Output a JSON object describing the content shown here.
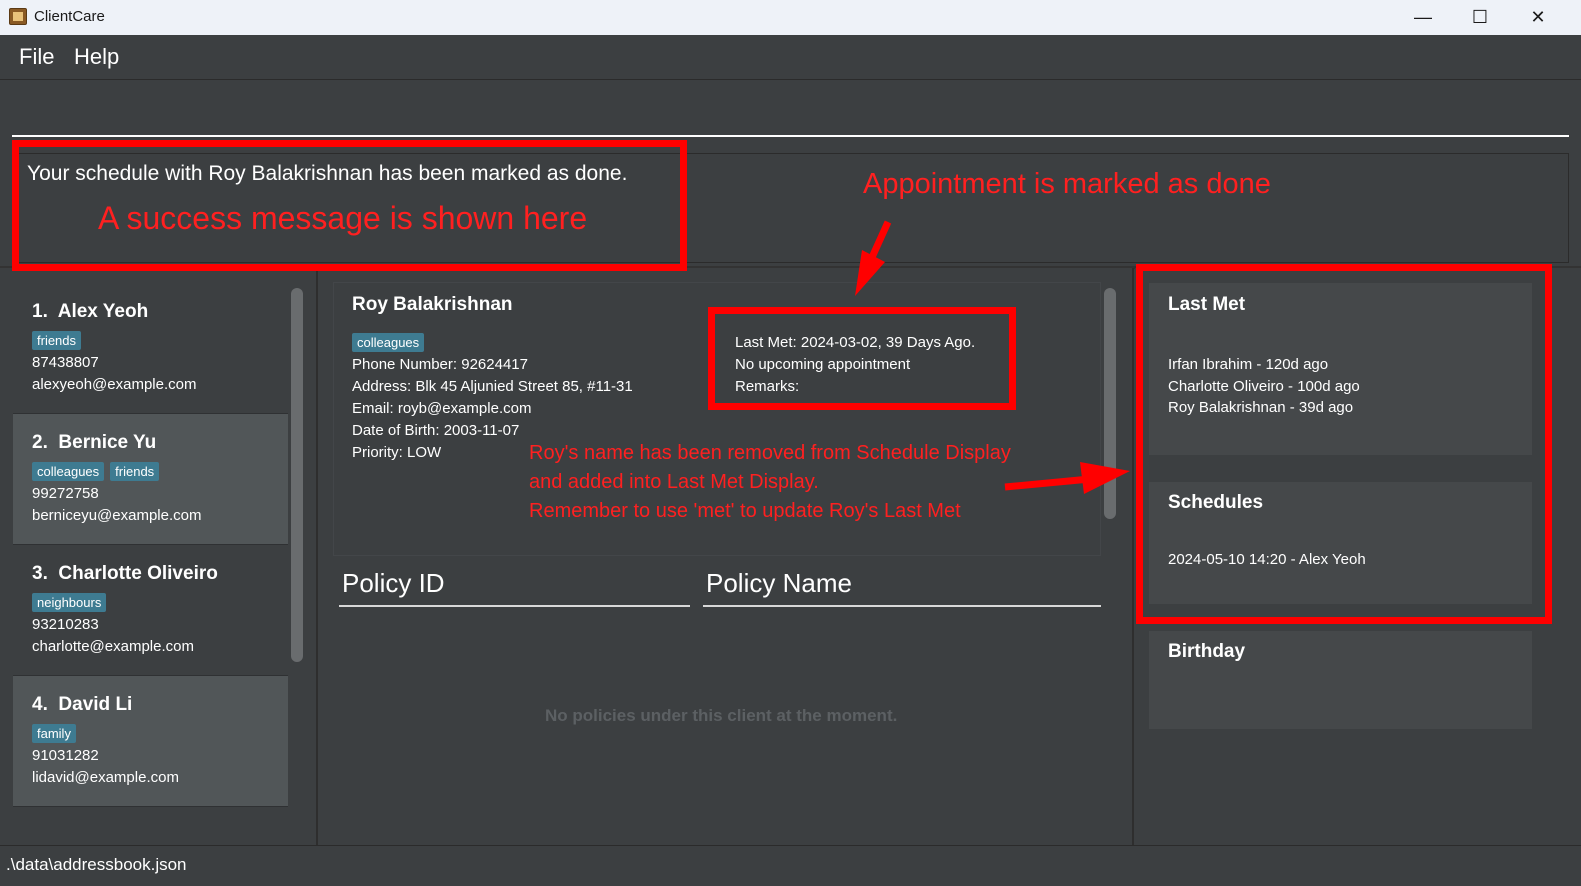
{
  "window": {
    "title": "ClientCare",
    "minimize_glyph": "—",
    "maximize_glyph": "☐",
    "close_glyph": "✕"
  },
  "menu": {
    "file": "File",
    "help": "Help"
  },
  "command": {
    "value": "",
    "placeholder": ""
  },
  "result": {
    "message": "Your schedule with Roy Balakrishnan has been marked as done."
  },
  "persons": [
    {
      "index": "1.",
      "name": "Alex Yeoh",
      "tags": [
        "friends"
      ],
      "phone": "87438807",
      "email": "alexyeoh@example.com"
    },
    {
      "index": "2.",
      "name": "Bernice Yu",
      "tags": [
        "colleagues",
        "friends"
      ],
      "phone": "99272758",
      "email": "berniceyu@example.com"
    },
    {
      "index": "3.",
      "name": "Charlotte Oliveiro",
      "tags": [
        "neighbours"
      ],
      "phone": "93210283",
      "email": "charlotte@example.com"
    },
    {
      "index": "4.",
      "name": "David Li",
      "tags": [
        "family"
      ],
      "phone": "91031282",
      "email": "lidavid@example.com"
    }
  ],
  "client": {
    "name": "Roy Balakrishnan",
    "tag": "colleagues",
    "phone": "Phone Number: 92624417",
    "address": "Address: Blk 45 Aljunied Street 85, #11-31",
    "email": "Email: royb@example.com",
    "dob": "Date of Birth: 2003-11-07",
    "priority": "Priority: LOW",
    "last_met": "Last Met: 2024-03-02, 39 Days Ago.",
    "appointment": "No upcoming appointment",
    "remarks": "Remarks:"
  },
  "policy_table": {
    "id_header": "Policy ID",
    "name_header": "Policy Name",
    "empty_message": "No policies under this client at the moment."
  },
  "last_met": {
    "title": "Last Met",
    "items": [
      "Irfan Ibrahim - 120d ago",
      "Charlotte Oliveiro - 100d ago",
      "Roy Balakrishnan - 39d ago"
    ]
  },
  "schedules": {
    "title": "Schedules",
    "items": [
      "2024-05-10 14:20 - Alex Yeoh"
    ]
  },
  "birthday": {
    "title": "Birthday"
  },
  "status_bar": {
    "path": ".\\data\\addressbook.json"
  },
  "annotations": {
    "success": "A success message is shown here",
    "appointment_done": "Appointment is marked as done",
    "removed_line1": "Roy's name has been removed from Schedule Display",
    "removed_line2": "and added into Last Met Display.",
    "removed_line3": "Remember to use 'met' to update Roy's Last Met"
  },
  "colors": {
    "background": "#3c3f41",
    "tag": "#3e7b91",
    "selected_card": "#515658",
    "annotation": "#ff0000"
  }
}
